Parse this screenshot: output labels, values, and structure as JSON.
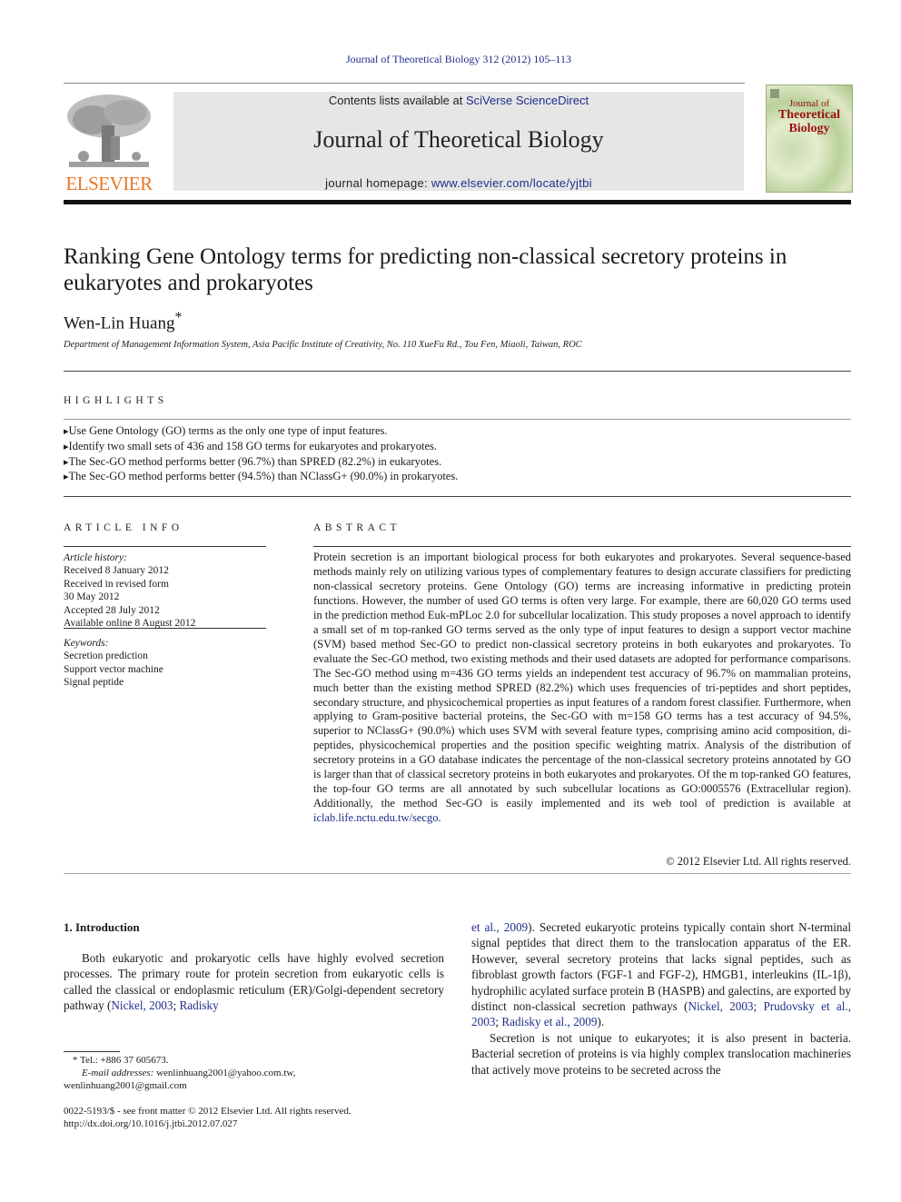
{
  "header": {
    "citation": "Journal of Theoretical Biology 312 (2012) 105–113",
    "contents_prefix": "Contents lists available at ",
    "contents_link": "SciVerse ScienceDirect",
    "journal_title": "Journal of Theoretical Biology",
    "homepage_prefix": "journal homepage: ",
    "homepage_link": "www.elsevier.com/locate/yjtbi",
    "publisher_logo_text": "ELSEVIER",
    "cover": {
      "line1": "Journal of",
      "line2": "Theoretical",
      "line3": "Biology"
    },
    "colors": {
      "elsevier_orange": "#e87722",
      "link_blue": "#1f2e8c",
      "cover_red": "#9a1010"
    }
  },
  "article": {
    "title": "Ranking Gene Ontology terms for predicting non-classical secretory proteins in eukaryotes and prokaryotes",
    "author": "Wen-Lin Huang",
    "author_mark": "*",
    "affiliation": "Department of Management Information System, Asia Pacific Institute of Creativity, No. 110 XueFu Rd., Tou Fen, Miaoli, Taiwan, ROC"
  },
  "highlights": {
    "heading": "HIGHLIGHTS",
    "items": [
      "Use Gene Ontology (GO) terms as the only one type of input features.",
      "Identify two small sets of 436 and 158 GO terms for eukaryotes and prokaryotes.",
      "The Sec-GO method performs better (96.7%) than SPRED (82.2%) in eukaryotes.",
      "The Sec-GO method performs better (94.5%) than NClassG+ (90.0%) in prokaryotes."
    ]
  },
  "article_info": {
    "heading": "ARTICLE INFO",
    "history_label": "Article history:",
    "history": [
      "Received 8 January 2012",
      "Received in revised form",
      "30 May 2012",
      "Accepted 28 July 2012",
      "Available online 8 August 2012"
    ],
    "keywords_label": "Keywords:",
    "keywords": [
      "Secretion prediction",
      "Support vector machine",
      "Signal peptide"
    ]
  },
  "abstract": {
    "heading": "ABSTRACT",
    "text": "Protein secretion is an important biological process for both eukaryotes and prokaryotes. Several sequence-based methods mainly rely on utilizing various types of complementary features to design accurate classifiers for predicting non-classical secretory proteins. Gene Ontology (GO) terms are increasing informative in predicting protein functions. However, the number of used GO terms is often very large. For example, there are 60,020 GO terms used in the prediction method Euk-mPLoc 2.0 for subcellular localization. This study proposes a novel approach to identify a small set of m top-ranked GO terms served as the only type of input features to design a support vector machine (SVM) based method Sec-GO to predict non-classical secretory proteins in both eukaryotes and prokaryotes. To evaluate the Sec-GO method, two existing methods and their used datasets are adopted for performance comparisons. The Sec-GO method using m=436 GO terms yields an independent test accuracy of 96.7% on mammalian proteins, much better than the existing method SPRED (82.2%) which uses frequencies of tri-peptides and short peptides, secondary structure, and physicochemical properties as input features of a random forest classifier. Furthermore, when applying to Gram-positive bacterial proteins, the Sec-GO with m=158 GO terms has a test accuracy of 94.5%, superior to NClassG+ (90.0%) which uses SVM with several feature types, comprising amino acid composition, di-peptides, physicochemical properties and the position specific weighting matrix. Analysis of the distribution of secretory proteins in a GO database indicates the percentage of the non-classical secretory proteins annotated by GO is larger than that of classical secretory proteins in both eukaryotes and prokaryotes. Of the m top-ranked GO features, the top-four GO terms are all annotated by such subcellular locations as GO:0005576 (Extracellular region). Additionally, the method Sec-GO is easily implemented and its web tool of prediction is available at ",
    "link": "iclab.life.nctu.edu.tw/secgo",
    "end": ".",
    "copyright": "© 2012 Elsevier Ltd. All rights reserved."
  },
  "introduction": {
    "heading": "1.  Introduction",
    "col1": {
      "p1_text": "Both eukaryotic and prokaryotic cells have highly evolved secretion processes. The primary route for protein secretion from eukaryotic cells is called the classical or endoplasmic reticulum (ER)/Golgi-dependent secretory pathway (",
      "p1_ref1": "Nickel, 2003",
      "p1_sep": "; ",
      "p1_ref2": "Radisky"
    },
    "col2": {
      "p1_ref_cont": "et al., 2009",
      "p1_text": "). Secreted eukaryotic proteins typically contain short N-terminal signal peptides that direct them to the translocation apparatus of the ER. However, several secretory proteins that lacks signal peptides, such as fibroblast growth factors (FGF-1 and FGF-2), HMGB1, interleukins (IL-1β), hydrophilic acylated surface protein B (HASPB) and galectins, are exported by distinct non-classical secretion pathways (",
      "p1_ref1": "Nickel, 2003",
      "p1_sep1": "; ",
      "p1_ref2": "Prudovsky et al., 2003",
      "p1_sep2": "; ",
      "p1_ref3": "Radisky et al., 2009",
      "p1_end": ").",
      "p2_text": "Secretion is not unique to eukaryotes; it is also present in bacteria. Bacterial secretion of proteins is via highly complex translocation machineries that actively move proteins to be secreted across the"
    }
  },
  "footnote": {
    "tel": "* Tel.: +886 37 605673.",
    "email_label": "E-mail addresses:",
    "email1": " wenlinhuang2001@yahoo.com.tw,",
    "email2": "wenlinhuang2001@gmail.com"
  },
  "front_matter": {
    "issn_line": "0022-5193/$ - see front matter © 2012 Elsevier Ltd. All rights reserved.",
    "doi": "http://dx.doi.org/10.1016/j.jtbi.2012.07.027"
  }
}
